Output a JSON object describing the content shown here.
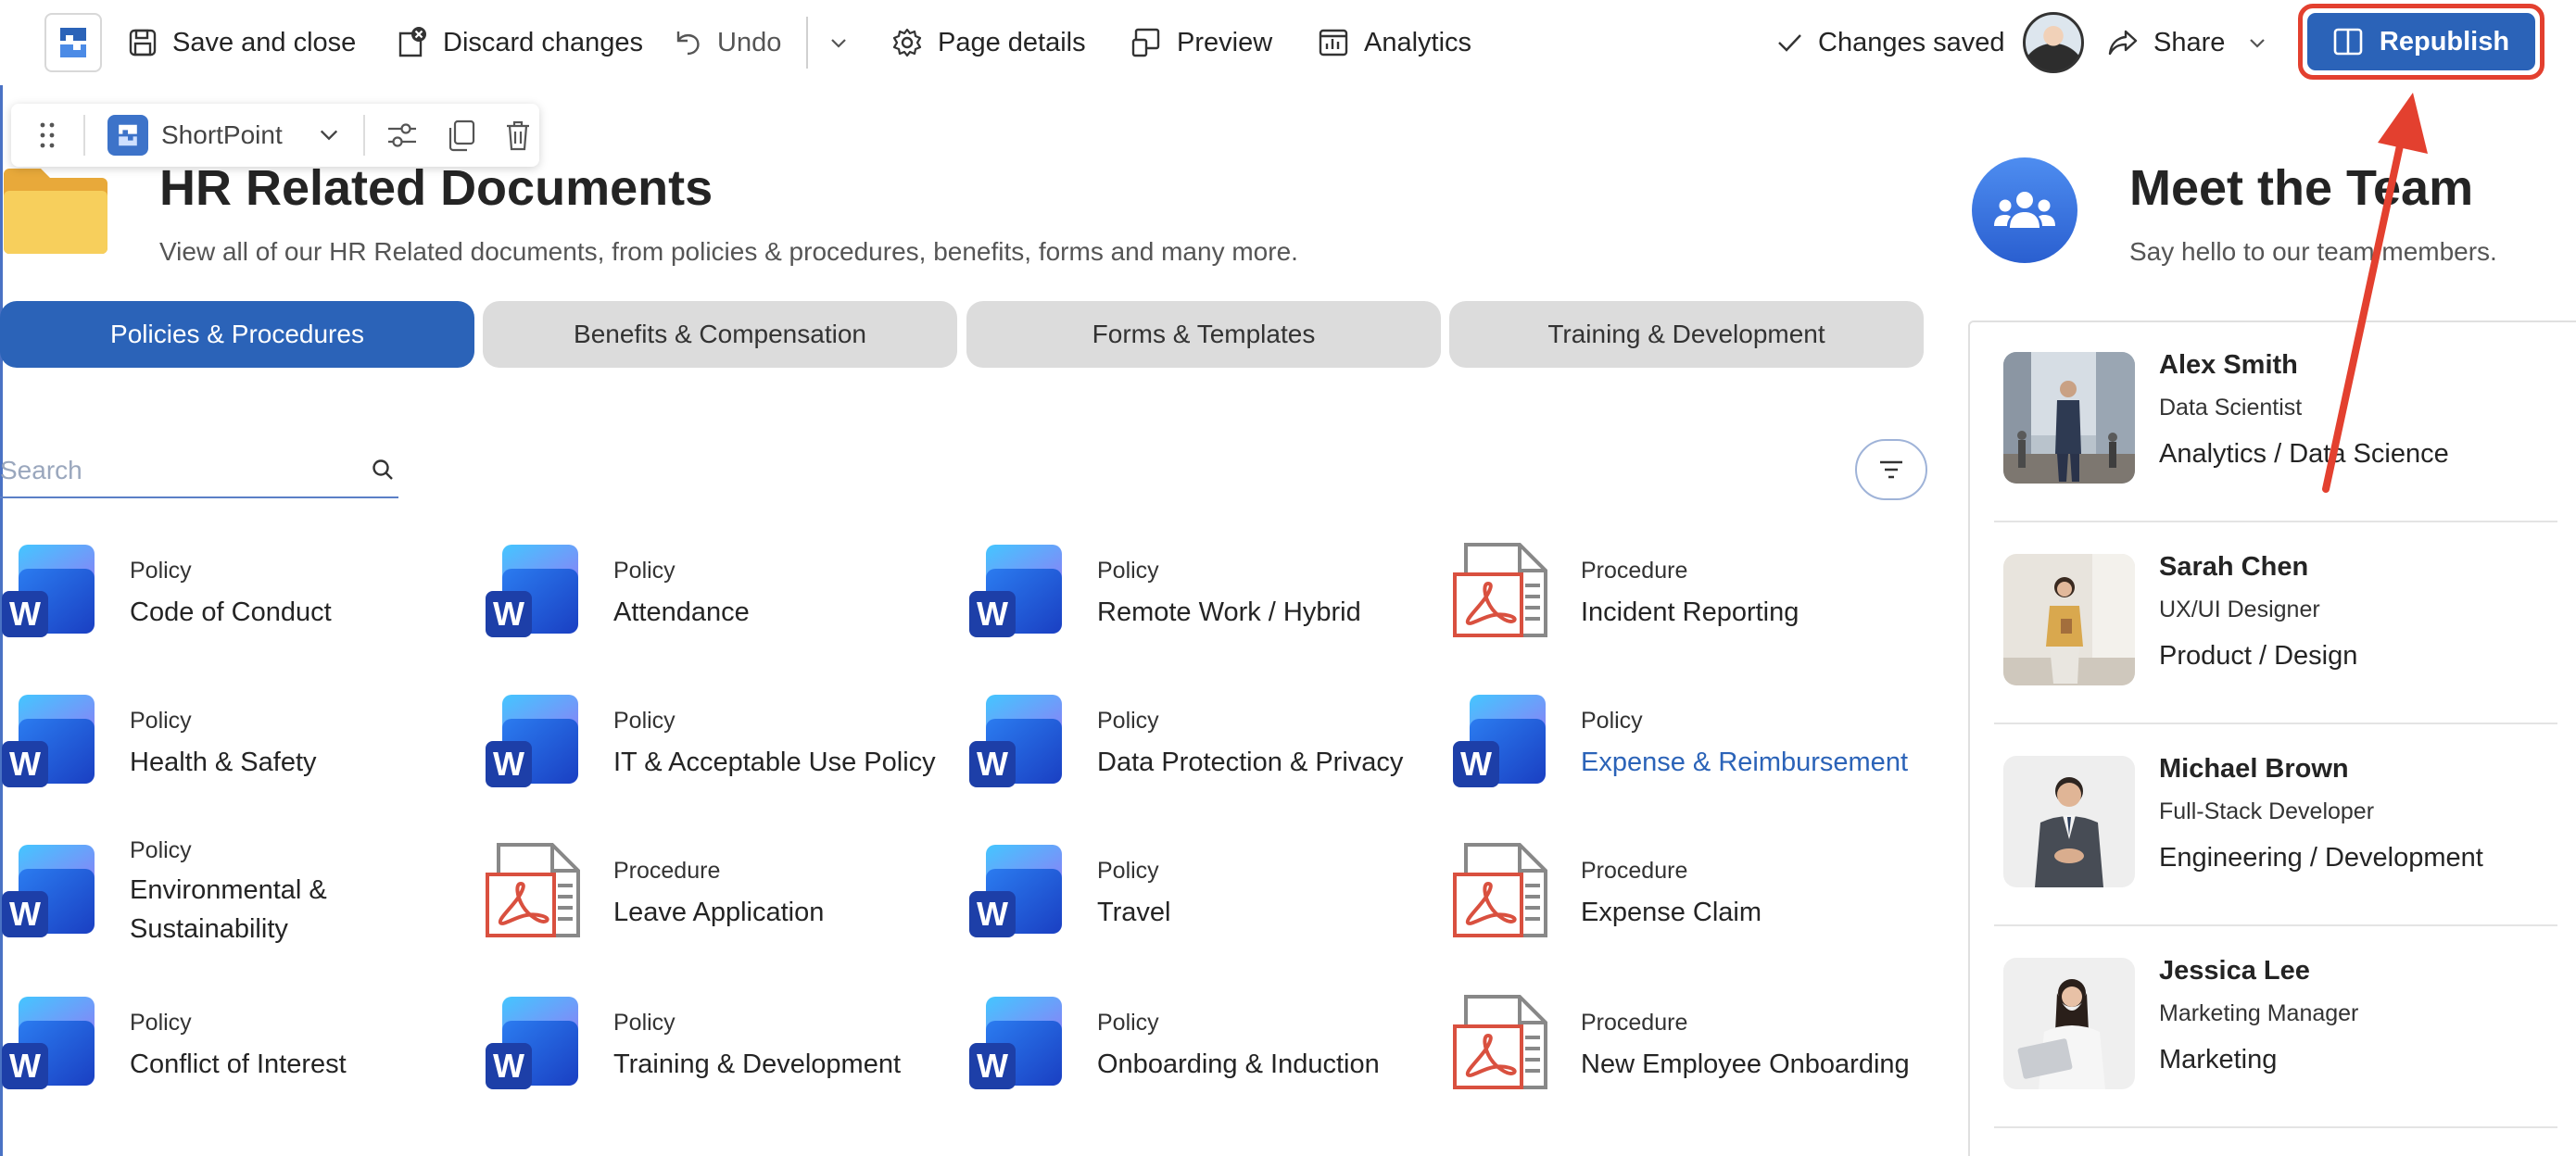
{
  "toolbar": {
    "save_close": "Save and close",
    "discard": "Discard changes",
    "undo": "Undo",
    "page_details": "Page details",
    "preview": "Preview",
    "analytics": "Analytics",
    "status": "Changes saved",
    "share": "Share",
    "republish": "Republish"
  },
  "webpart_toolbar": {
    "name": "ShortPoint"
  },
  "header": {
    "title": "HR Related Documents",
    "subtitle": "View all of our HR Related documents, from policies & procedures, benefits, forms and many more."
  },
  "tabs": [
    {
      "label": "Policies & Procedures",
      "active": true
    },
    {
      "label": "Benefits & Compensation",
      "active": false
    },
    {
      "label": "Forms & Templates",
      "active": false
    },
    {
      "label": "Training & Development",
      "active": false
    }
  ],
  "search": {
    "placeholder": "Search"
  },
  "documents": [
    {
      "type": "Policy",
      "title": "Code of Conduct",
      "icon": "word-icon"
    },
    {
      "type": "Policy",
      "title": "Attendance",
      "icon": "word-icon"
    },
    {
      "type": "Policy",
      "title": "Remote Work / Hybrid",
      "icon": "word-icon"
    },
    {
      "type": "Procedure",
      "title": "Incident Reporting",
      "icon": "pdf-icon"
    },
    {
      "type": "Policy",
      "title": "Health & Safety",
      "icon": "word-icon"
    },
    {
      "type": "Policy",
      "title": "IT & Acceptable Use Policy",
      "icon": "word-icon"
    },
    {
      "type": "Policy",
      "title": "Data Protection & Privacy",
      "icon": "word-icon"
    },
    {
      "type": "Policy",
      "title": "Expense & Reimbursement",
      "icon": "word-icon"
    },
    {
      "type": "Policy",
      "title": "Environmental & Sustainability",
      "icon": "word-icon"
    },
    {
      "type": "Procedure",
      "title": "Leave Application",
      "icon": "pdf-icon"
    },
    {
      "type": "Policy",
      "title": "Travel",
      "icon": "word-icon"
    },
    {
      "type": "Procedure",
      "title": "Expense Claim",
      "icon": "pdf-icon"
    },
    {
      "type": "Policy",
      "title": "Conflict of Interest",
      "icon": "word-icon"
    },
    {
      "type": "Policy",
      "title": "Training & Development",
      "icon": "word-icon"
    },
    {
      "type": "Policy",
      "title": "Onboarding & Induction",
      "icon": "word-icon"
    },
    {
      "type": "Procedure",
      "title": "New Employee Onboarding",
      "icon": "pdf-icon"
    }
  ],
  "team": {
    "title": "Meet the Team",
    "subtitle": "Say hello to our team members.",
    "members": [
      {
        "name": "Alex Smith",
        "role": "Data Scientist",
        "dept": "Analytics / Data Science"
      },
      {
        "name": "Sarah Chen",
        "role": "UX/UI Designer",
        "dept": "Product / Design"
      },
      {
        "name": "Michael Brown",
        "role": "Full-Stack Developer",
        "dept": "Engineering / Development"
      },
      {
        "name": "Jessica Lee",
        "role": "Marketing Manager",
        "dept": "Marketing"
      }
    ]
  },
  "colors": {
    "accent": "#2b63b8",
    "annotation": "#e3402f",
    "tab_inactive": "#dcdcdc",
    "pdf_red": "#d9503f"
  }
}
